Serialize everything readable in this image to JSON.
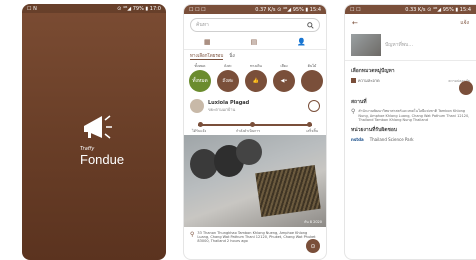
{
  "screen1": {
    "status_left": "☐ N",
    "status_right": "⊙ ⁴ᴳ◢ 79% ▮ 17:0",
    "brand_small": "Traffy",
    "brand_large": "Fondue"
  },
  "screen2": {
    "status_left": "☐ ☐ ☐",
    "status_right": "0.37 K/s ⊙ ⁴ᴳ◢ 95% ▮ 15:4",
    "search_placeholder": "ค้นหา",
    "subtabs": [
      "ทางเลือกโดยรอบ",
      "นิ่ง"
    ],
    "categories": [
      {
        "label": "ทั้งหมด",
        "text": "ทั้งหมด"
      },
      {
        "label": "ถังสะ",
        "text": "ถังสะ"
      },
      {
        "label": "ทางเดิน",
        "text": "👍"
      },
      {
        "label": "เสียง",
        "text": "◀•"
      },
      {
        "label": "ต้นไม้",
        "text": ""
      }
    ],
    "post": {
      "name": "Luxiola Plagad",
      "sub": "ขยะตามแก่บ้าน",
      "timeline": [
        "ได้รับแจ้ง",
        "กำลังดำเนินการ",
        "เสร็จสิ้น"
      ],
      "photo_date": "กัน 8 2020",
      "address": "33 Thanon Thungkhao Tambon Khlong Nueng, Amphoe Khlong Luang, Chang Wat Pathum Thani 12120, Phuket, Chang Wat Phuket 83000, Thailand 2 hours ago"
    }
  },
  "screen3": {
    "status_left": "☐ ☐",
    "status_right": "0.33 K/s ⊙ ⁴ᴳ◢ 95% ▮ 15:4",
    "back": "←",
    "send": "แจ้ง",
    "placeholder": "ปัญหาที่พบ...",
    "category_title": "เลือกหมวดหมู่ปัญหา",
    "category_checkbox": "ความสะอาด",
    "category_right": "ความปลอดภัย",
    "location_title": "สถานที่",
    "location_text": "สำนักงานพัฒนาวิทยาศาสตร์และเทคโนโลยีแห่งชาติ Tambon Khlong Nung, Amphoe Khlong Luang, Chang Wat Pathum Thani 12120, Thailand Tambon Khlong Nung Thailand",
    "org_title": "หน่วยงานที่รับผิดชอบ",
    "org_logo": "nstda",
    "org_name": "Thailand Science Park"
  }
}
